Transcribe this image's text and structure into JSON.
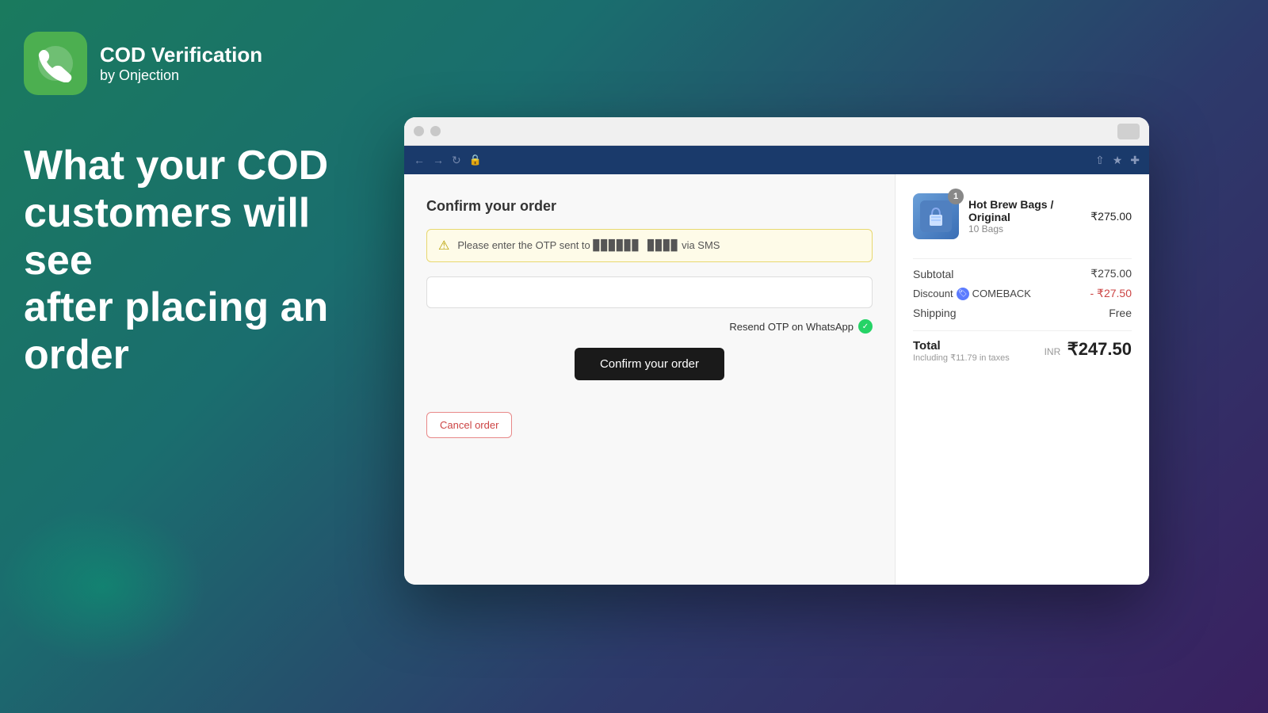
{
  "brand": {
    "app_name": "COD Verification",
    "app_subtitle": "by Onjection"
  },
  "hero": {
    "line1": "What your COD",
    "line2": "customers will see",
    "line3": "after placing an order"
  },
  "checkout": {
    "title": "Confirm your order",
    "otp_alert": "Please enter the OTP sent to ██████ ████ via SMS",
    "otp_placeholder": "",
    "resend_label": "Resend OTP on WhatsApp",
    "confirm_button": "Confirm your order",
    "cancel_button": "Cancel order"
  },
  "order": {
    "item": {
      "name": "Hot Brew Bags / Original",
      "variant": "10 Bags",
      "price": "₹275.00",
      "badge": "1"
    },
    "subtotal_label": "Subtotal",
    "subtotal_value": "₹275.00",
    "discount_label": "Discount",
    "discount_code": "COMEBACK",
    "discount_value": "- ₹27.50",
    "shipping_label": "Shipping",
    "shipping_value": "Free",
    "total_label": "Total",
    "total_tax": "Including ₹11.79 in taxes",
    "total_currency": "INR",
    "total_value": "₹247.50"
  },
  "browser": {
    "toolbar_icons": [
      "arrow-back",
      "arrow-forward",
      "refresh",
      "lock",
      "share",
      "star",
      "puzzle"
    ]
  }
}
